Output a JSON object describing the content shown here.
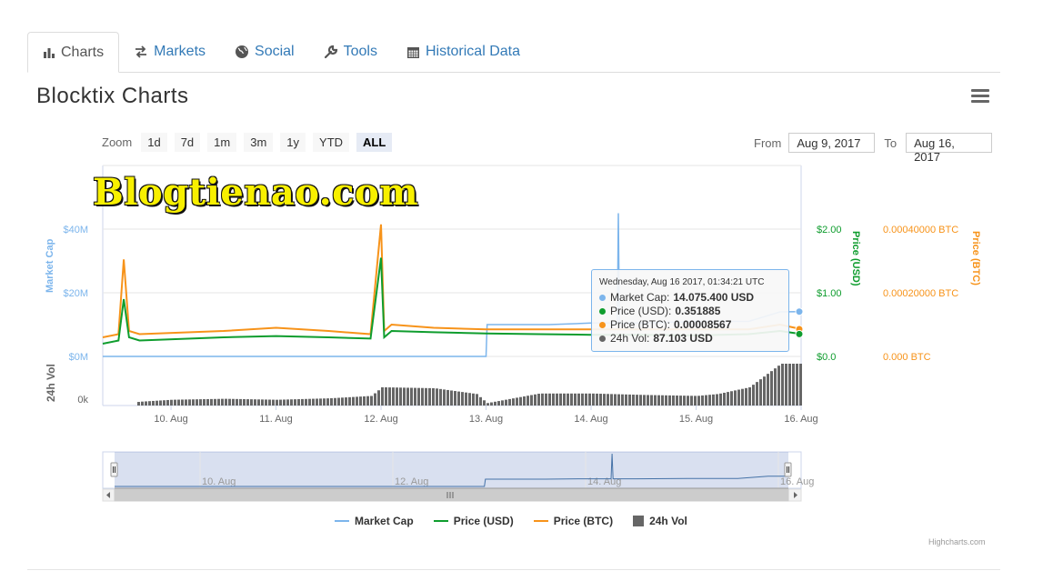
{
  "tabs": [
    {
      "label": "Charts",
      "icon": "bar-chart-icon",
      "active": true
    },
    {
      "label": "Markets",
      "icon": "exchange-icon",
      "active": false
    },
    {
      "label": "Social",
      "icon": "globe-icon",
      "active": false
    },
    {
      "label": "Tools",
      "icon": "wrench-icon",
      "active": false
    },
    {
      "label": "Historical Data",
      "icon": "calendar-icon",
      "active": false
    }
  ],
  "page_title": "Blocktix Charts",
  "range_selector": {
    "zoom_label": "Zoom",
    "buttons": [
      "1d",
      "7d",
      "1m",
      "3m",
      "1y",
      "YTD",
      "ALL"
    ],
    "selected": "ALL",
    "from_label": "From",
    "from_value": "Aug 9, 2017",
    "to_label": "To",
    "to_value": "Aug 16, 2017"
  },
  "watermark": "Blogtienao.com",
  "tooltip": {
    "date": "Wednesday, Aug 16 2017, 01:34:21 UTC",
    "rows": [
      {
        "label": "Market Cap:",
        "value": "14.075.400 USD",
        "color": "#7cb5ec"
      },
      {
        "label": "Price (USD):",
        "value": "0.351885",
        "color": "#0f9d2e"
      },
      {
        "label": "Price (BTC):",
        "value": "0.00008567",
        "color": "#f7931a"
      },
      {
        "label": "24h Vol:",
        "value": "87.103 USD",
        "color": "#666666"
      }
    ]
  },
  "legend": [
    {
      "name": "Market Cap",
      "color": "#7cb5ec",
      "type": "line"
    },
    {
      "name": "Price (USD)",
      "color": "#0f9d2e",
      "type": "line"
    },
    {
      "name": "Price (BTC)",
      "color": "#f7931a",
      "type": "line"
    },
    {
      "name": "24h Vol",
      "color": "#666666",
      "type": "box"
    }
  ],
  "credits": "Highcharts.com",
  "chart_data": {
    "type": "line",
    "x_ticks": [
      "10. Aug",
      "11. Aug",
      "12. Aug",
      "13. Aug",
      "14. Aug",
      "15. Aug",
      "16. Aug"
    ],
    "x_range_days": [
      9.35,
      16.0
    ],
    "axes": {
      "market_cap": {
        "title": "Market Cap",
        "ticks": [
          "$0M",
          "$20M",
          "$40M"
        ],
        "range": [
          0,
          40000000
        ],
        "color": "#7cb5ec"
      },
      "price_usd": {
        "title": "Price (USD)",
        "ticks": [
          "$0.0",
          "$1.00",
          "$2.00"
        ],
        "range": [
          0,
          2
        ],
        "color": "#0f9d2e"
      },
      "price_btc": {
        "title": "Price (BTC)",
        "ticks": [
          "0.000 BTC",
          "0.00020000 BTC",
          "0.00040000 BTC"
        ],
        "range": [
          0,
          0.0004
        ],
        "color": "#f7931a"
      },
      "volume": {
        "title": "24h Vol",
        "ticks": [
          "0k"
        ],
        "color": "#666666"
      }
    },
    "series": [
      {
        "name": "Market Cap",
        "axis": "market_cap",
        "color": "#7cb5ec",
        "x": [
          9.35,
          13.0,
          13.01,
          13.6,
          14.0,
          14.25,
          14.26,
          14.27,
          14.5,
          15.0,
          15.5,
          15.8,
          16.0
        ],
        "y": [
          0,
          0,
          10000000,
          10000000,
          10500000,
          10500000,
          45000000,
          10500000,
          10500000,
          11000000,
          11000000,
          14000000,
          14075400
        ]
      },
      {
        "name": "Price (USD)",
        "axis": "price_usd",
        "color": "#0f9d2e",
        "x": [
          9.35,
          9.5,
          9.55,
          9.6,
          9.7,
          10.5,
          11.0,
          11.5,
          11.9,
          12.0,
          12.03,
          12.1,
          12.5,
          13.0,
          13.5,
          14.0,
          14.5,
          15.0,
          15.5,
          15.8,
          16.0
        ],
        "y": [
          0.2,
          0.25,
          0.9,
          0.3,
          0.25,
          0.3,
          0.32,
          0.3,
          0.28,
          1.55,
          0.3,
          0.4,
          0.38,
          0.36,
          0.35,
          0.34,
          0.34,
          0.33,
          0.35,
          0.4,
          0.351885
        ]
      },
      {
        "name": "Price (BTC)",
        "axis": "price_btc",
        "color": "#f7931a",
        "x": [
          9.35,
          9.5,
          9.55,
          9.6,
          9.7,
          10.5,
          11.0,
          11.5,
          11.9,
          12.0,
          12.03,
          12.1,
          12.5,
          13.0,
          13.5,
          14.0,
          14.5,
          15.0,
          15.5,
          15.8,
          16.0
        ],
        "y": [
          6e-05,
          7e-05,
          0.000305,
          8e-05,
          7e-05,
          8e-05,
          9e-05,
          8e-05,
          7e-05,
          0.000415,
          8e-05,
          0.0001,
          9e-05,
          8.5e-05,
          8.5e-05,
          8.5e-05,
          8.5e-05,
          8.5e-05,
          8.5e-05,
          0.0001,
          8.567e-05
        ]
      },
      {
        "name": "24h Vol",
        "axis": "volume",
        "color": "#666666",
        "type": "column",
        "x": [
          9.35,
          9.7,
          10.0,
          10.5,
          11.0,
          11.5,
          11.9,
          12.0,
          12.5,
          12.9,
          13.0,
          13.5,
          14.0,
          14.5,
          15.0,
          15.2,
          15.5,
          15.8,
          16.0
        ],
        "y": [
          0,
          8000,
          12000,
          14000,
          12000,
          15000,
          20000,
          38000,
          36000,
          24000,
          5000,
          25000,
          25000,
          22000,
          20000,
          24000,
          38000,
          87103,
          87103
        ]
      }
    ]
  }
}
